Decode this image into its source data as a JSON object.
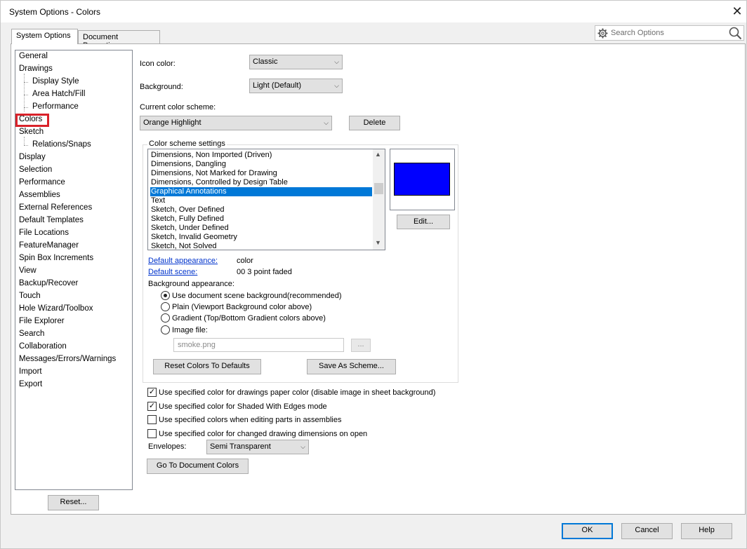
{
  "window": {
    "title": "System Options - Colors",
    "close_glyph": "✕"
  },
  "tabs": [
    {
      "label": "System Options",
      "active": true
    },
    {
      "label": "Document Properties",
      "active": false
    }
  ],
  "search": {
    "placeholder": "Search Options",
    "icon_left": "gear-icon",
    "icon_right": "magnifier-icon"
  },
  "tree": {
    "items": [
      {
        "label": "General",
        "level": 0
      },
      {
        "label": "Drawings",
        "level": 0
      },
      {
        "label": "Display Style",
        "level": 1
      },
      {
        "label": "Area Hatch/Fill",
        "level": 1
      },
      {
        "label": "Performance",
        "level": 1
      },
      {
        "label": "Colors",
        "level": 0,
        "selected": true
      },
      {
        "label": "Sketch",
        "level": 0
      },
      {
        "label": "Relations/Snaps",
        "level": 1
      },
      {
        "label": "Display",
        "level": 0
      },
      {
        "label": "Selection",
        "level": 0
      },
      {
        "label": "Performance",
        "level": 0
      },
      {
        "label": "Assemblies",
        "level": 0
      },
      {
        "label": "External References",
        "level": 0
      },
      {
        "label": "Default Templates",
        "level": 0
      },
      {
        "label": "File Locations",
        "level": 0
      },
      {
        "label": "FeatureManager",
        "level": 0
      },
      {
        "label": "Spin Box Increments",
        "level": 0
      },
      {
        "label": "View",
        "level": 0
      },
      {
        "label": "Backup/Recover",
        "level": 0
      },
      {
        "label": "Touch",
        "level": 0
      },
      {
        "label": "Hole Wizard/Toolbox",
        "level": 0
      },
      {
        "label": "File Explorer",
        "level": 0
      },
      {
        "label": "Search",
        "level": 0
      },
      {
        "label": "Collaboration",
        "level": 0
      },
      {
        "label": "Messages/Errors/Warnings",
        "level": 0
      },
      {
        "label": "Import",
        "level": 0
      },
      {
        "label": "Export",
        "level": 0
      }
    ],
    "reset_label": "Reset..."
  },
  "colors": {
    "icon_color_label": "Icon color:",
    "icon_color_value": "Classic",
    "background_label": "Background:",
    "background_value": "Light (Default)",
    "scheme_label": "Current color scheme:",
    "scheme_value": "Orange Highlight",
    "delete_label": "Delete",
    "settings_group_label": "Color scheme settings",
    "settings_items": [
      {
        "label": "Dimensions, Non Imported (Driven)"
      },
      {
        "label": "Dimensions, Dangling"
      },
      {
        "label": "Dimensions, Not Marked for Drawing"
      },
      {
        "label": "Dimensions, Controlled by Design Table"
      },
      {
        "label": "Graphical Annotations",
        "selected": true
      },
      {
        "label": "Text"
      },
      {
        "label": "Sketch, Over Defined"
      },
      {
        "label": "Sketch, Fully Defined"
      },
      {
        "label": "Sketch, Under Defined"
      },
      {
        "label": "Sketch, Invalid Geometry"
      },
      {
        "label": "Sketch, Not Solved"
      }
    ],
    "swatch_color": "#0000ff",
    "edit_label": "Edit...",
    "default_appearance_label": "Default appearance:",
    "default_appearance_value": "color",
    "default_scene_label": "Default scene:",
    "default_scene_value": "00 3 point faded",
    "bg_appearance_label": "Background appearance:",
    "bg_options": [
      {
        "label": "Use document scene background(recommended)",
        "checked": true
      },
      {
        "label": "Plain (Viewport Background color above)",
        "checked": false
      },
      {
        "label": "Gradient (Top/Bottom Gradient colors above)",
        "checked": false
      },
      {
        "label": "Image file:",
        "checked": false
      }
    ],
    "image_file_value": "smoke.png",
    "browse_label": "...",
    "reset_colors_label": "Reset Colors To Defaults",
    "save_scheme_label": "Save As Scheme...",
    "checkboxes": [
      {
        "label": "Use specified color for drawings paper color (disable image in sheet background)",
        "checked": true
      },
      {
        "label": "Use specified color for Shaded With Edges mode",
        "checked": true
      },
      {
        "label": "Use specified colors when editing parts in assemblies",
        "checked": false
      },
      {
        "label": "Use specified color for changed drawing dimensions on open",
        "checked": false
      }
    ],
    "envelopes_label": "Envelopes:",
    "envelopes_value": "Semi Transparent",
    "goto_doc_colors_label": "Go To Document Colors"
  },
  "footer": {
    "ok_label": "OK",
    "cancel_label": "Cancel",
    "help_label": "Help"
  }
}
